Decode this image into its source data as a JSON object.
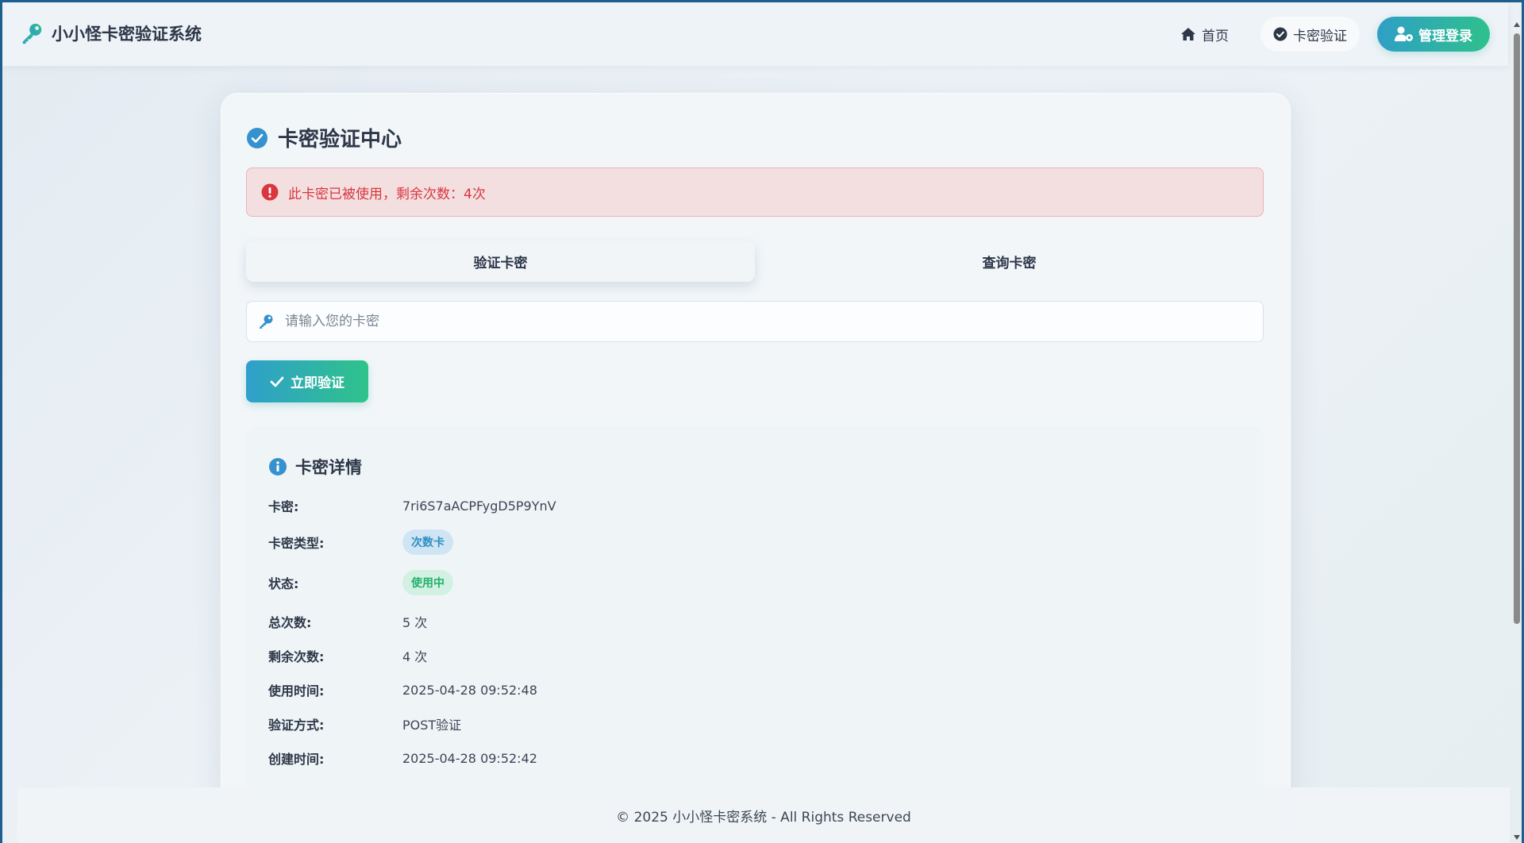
{
  "navbar": {
    "brand": "小小怪卡密验证系统",
    "links": [
      {
        "label": "首页",
        "icon": "home-icon"
      },
      {
        "label": "卡密验证",
        "icon": "check-circle-icon"
      }
    ],
    "login_label": "管理登录"
  },
  "main": {
    "title": "卡密验证中心",
    "alert": "此卡密已被使用，剩余次数：4次",
    "tabs": [
      {
        "label": "验证卡密",
        "active": true
      },
      {
        "label": "查询卡密",
        "active": false
      }
    ],
    "input_placeholder": "请输入您的卡密",
    "input_value": "",
    "verify_label": "立即验证"
  },
  "details": {
    "title": "卡密详情",
    "rows": [
      {
        "label": "卡密:",
        "value": "7ri6S7aACPFygD5P9YnV"
      },
      {
        "label": "卡密类型:",
        "value": "次数卡"
      },
      {
        "label": "状态:",
        "value": "使用中"
      },
      {
        "label": "总次数:",
        "value": "5 次"
      },
      {
        "label": "剩余次数:",
        "value": "4 次"
      },
      {
        "label": "使用时间:",
        "value": "2025-04-28 09:52:48"
      },
      {
        "label": "验证方式:",
        "value": "POST验证"
      },
      {
        "label": "创建时间:",
        "value": "2025-04-28 09:52:42"
      }
    ]
  },
  "footer": {
    "text": "© 2025 小小怪卡密系统 - All Rights Reserved"
  },
  "colors": {
    "accent": "#2f9fc6",
    "accent_green": "#2fc08c",
    "alert_text": "#d9363e",
    "alert_bg": "#f3dfe0"
  }
}
